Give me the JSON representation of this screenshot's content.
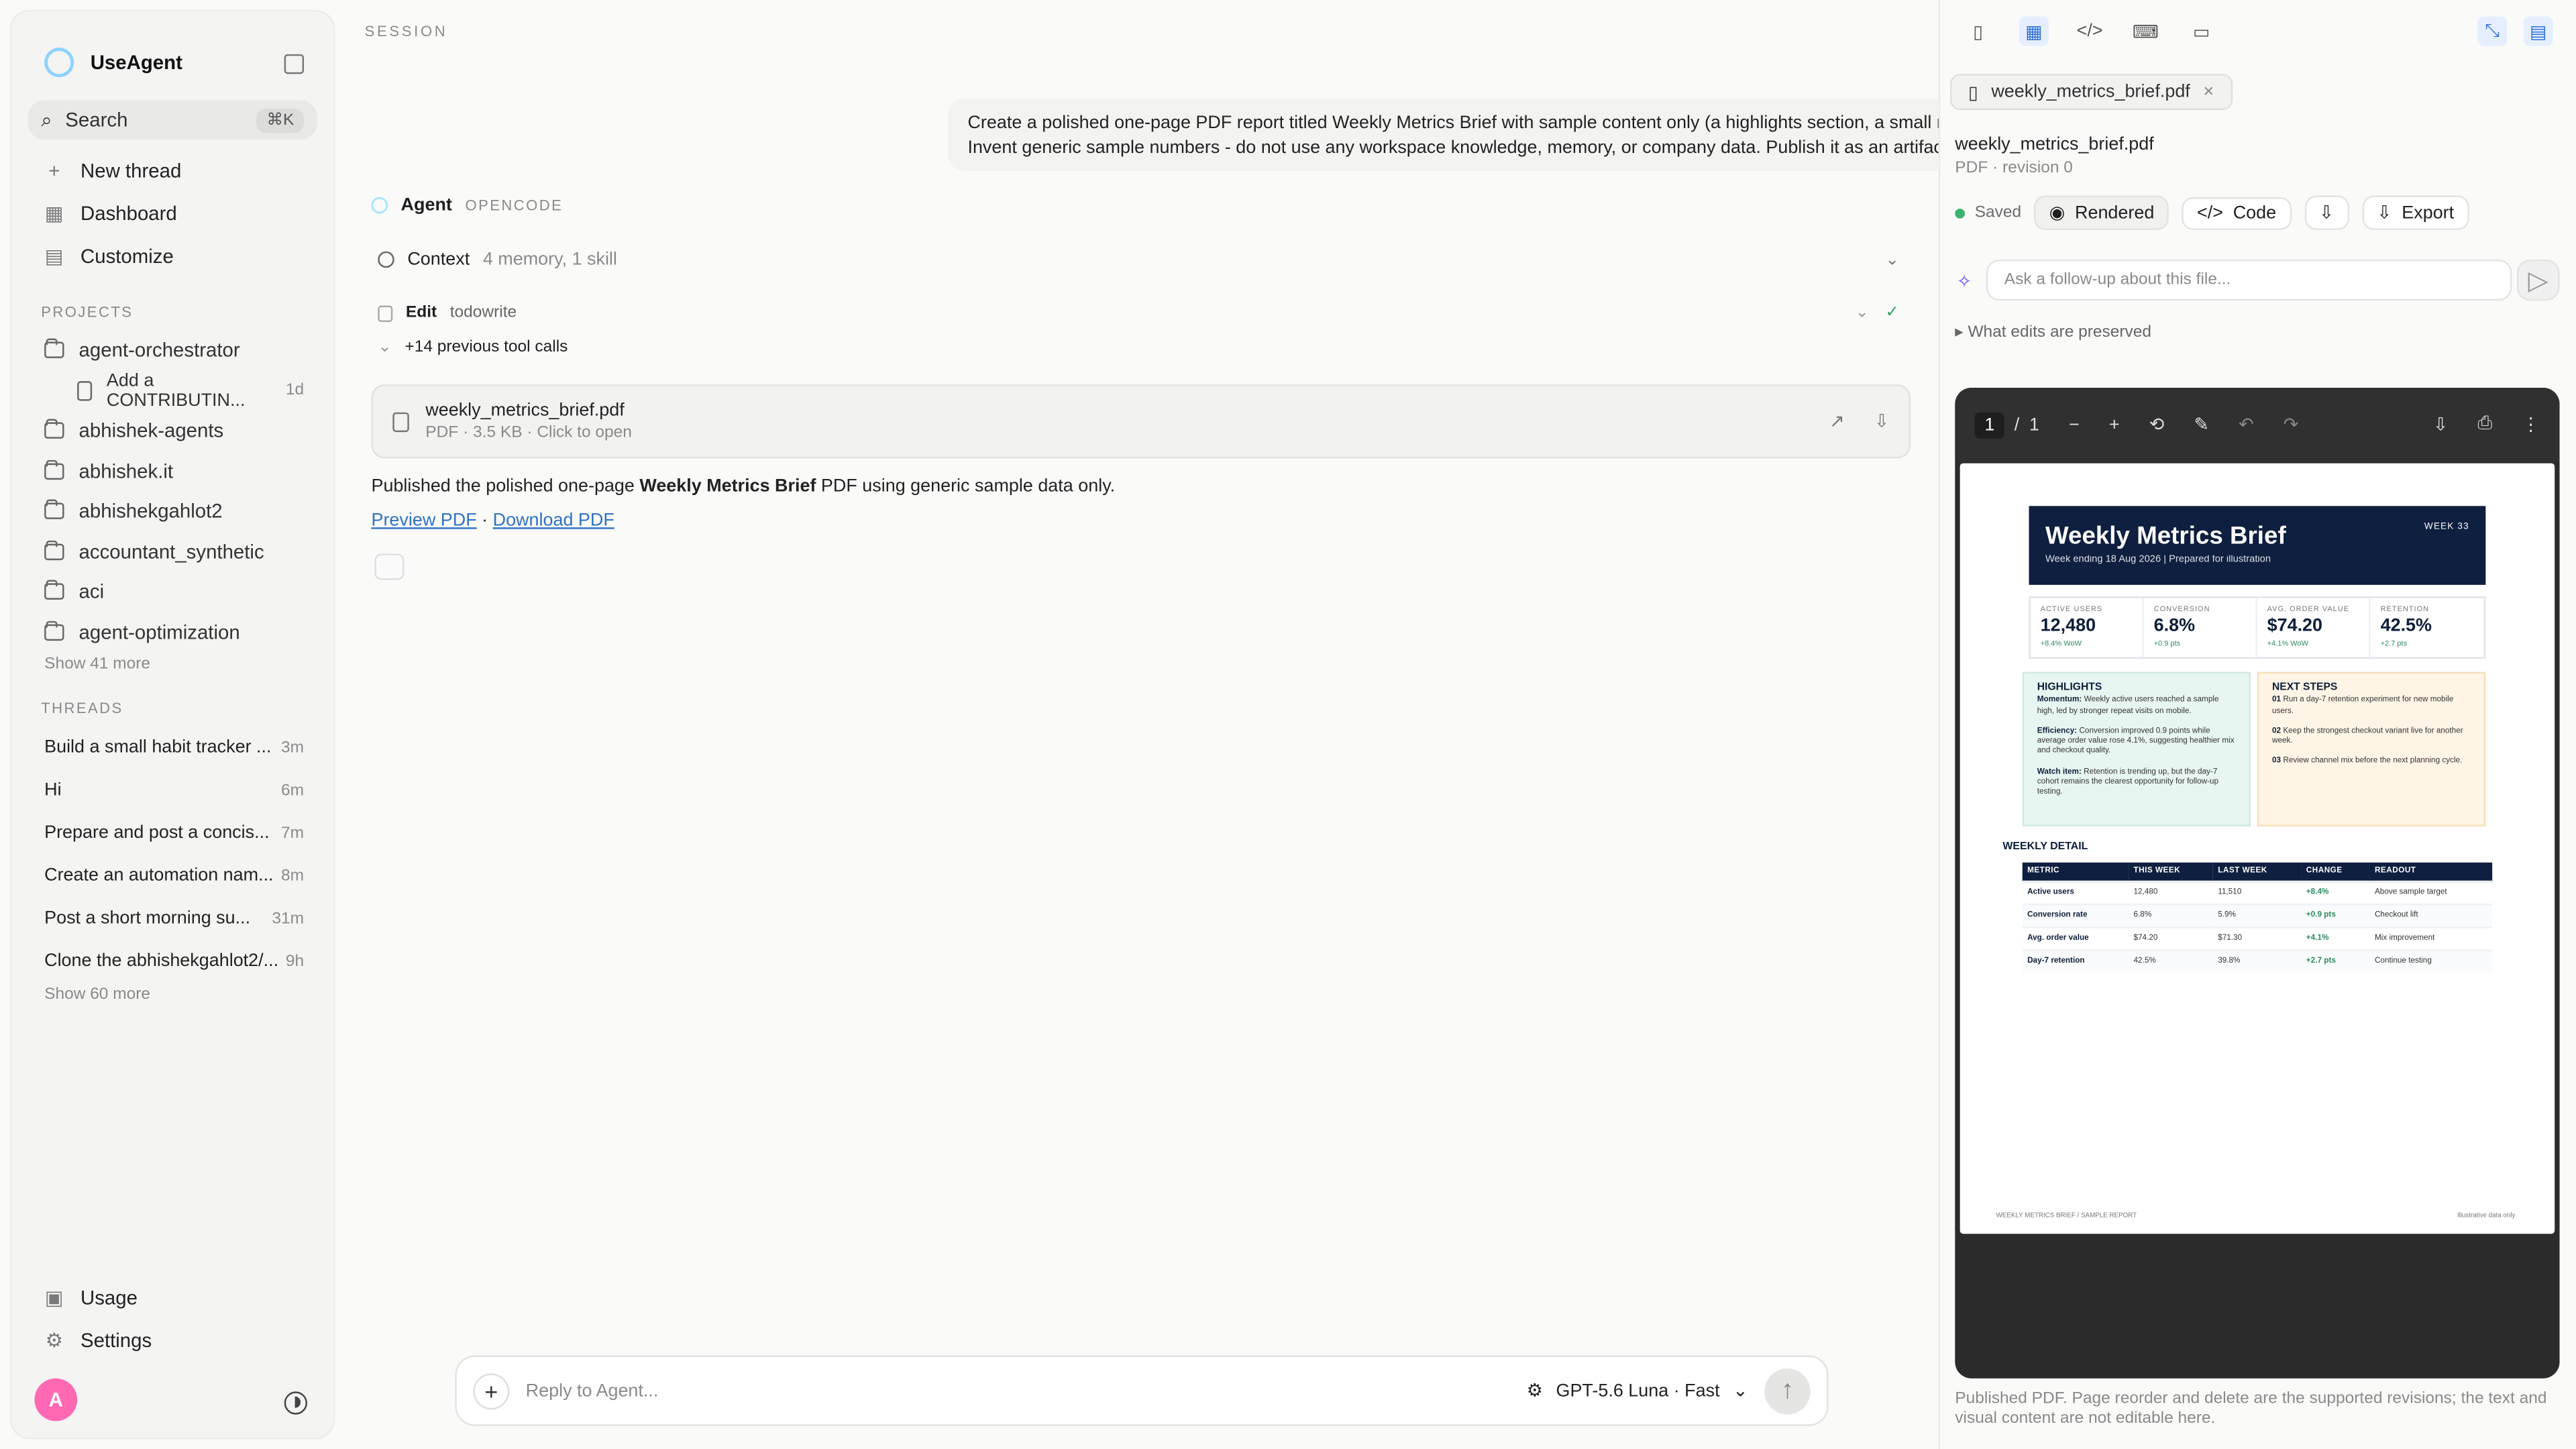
{
  "app": {
    "name": "UseAgent"
  },
  "sidebar": {
    "search": {
      "label": "Search",
      "shortcut": "⌘K"
    },
    "nav": [
      {
        "label": "New thread",
        "icon": "plus-icon"
      },
      {
        "label": "Dashboard",
        "icon": "grid-icon"
      },
      {
        "label": "Customize",
        "icon": "palette-icon"
      }
    ],
    "projects_title": "PROJECTS",
    "projects": [
      {
        "label": "agent-orchestrator"
      },
      {
        "label": "Add a CONTRIBUTIN...",
        "time": "1d",
        "sub": true
      },
      {
        "label": "abhishek-agents"
      },
      {
        "label": "abhishek.it"
      },
      {
        "label": "abhishekgahlot2"
      },
      {
        "label": "accountant_synthetic"
      },
      {
        "label": "aci"
      },
      {
        "label": "agent-optimization"
      }
    ],
    "projects_more": "Show 41 more",
    "threads_title": "THREADS",
    "threads": [
      {
        "label": "Build a small habit tracker ...",
        "time": "3m"
      },
      {
        "label": "Hi",
        "time": "6m"
      },
      {
        "label": "Prepare and post a concis...",
        "time": "7m"
      },
      {
        "label": "Create an automation nam...",
        "time": "8m"
      },
      {
        "label": "Post a short morning su...",
        "time": "31m"
      },
      {
        "label": "Clone the abhishekgahlot2/...",
        "time": "9h"
      }
    ],
    "threads_more": "Show 60 more",
    "bottom": [
      {
        "label": "Usage",
        "icon": "usage-icon"
      },
      {
        "label": "Settings",
        "icon": "gear-icon"
      }
    ],
    "avatar_letter": "A"
  },
  "main": {
    "session_label": "SESSION",
    "prompt": "Create a polished one-page PDF report titled Weekly Metrics Brief with sample content only (a highlights section, a small metrics table, a next steps list). Invent generic sample numbers - do not use any workspace knowledge, memory, or company data. Publish it as an artifact.",
    "agent_label": "Agent",
    "agent_tag": "OPENCODE",
    "context_label": "Context",
    "context_detail": "4 memory, 1 skill",
    "edit_label": "Edit",
    "edit_tool": "todowrite",
    "previous_calls": "+14 previous tool calls",
    "file": {
      "name": "weekly_metrics_brief.pdf",
      "meta": "PDF · 3.5 KB · Click to open"
    },
    "published_pre": "Published the polished one-page ",
    "published_bold": "Weekly Metrics Brief",
    "published_post": " PDF using generic sample data only.",
    "preview_link": "Preview PDF",
    "link_sep": " · ",
    "download_link": "Download PDF",
    "composer_placeholder": "Reply to Agent...",
    "model": "GPT-5.6 Luna · Fast"
  },
  "right": {
    "tab_label": "weekly_metrics_brief.pdf",
    "file_title": "weekly_metrics_brief.pdf",
    "file_sub": "PDF · revision 0",
    "saved": "Saved",
    "rendered": "Rendered",
    "code": "Code",
    "export": "Export",
    "ask_placeholder": "Ask a follow-up about this file...",
    "edits_preserved": "What edits are preserved",
    "viewer": {
      "page": "1",
      "sep": "/",
      "total": "1"
    },
    "footnote": "Published PDF. Page reorder and delete are the supported revisions; the text and visual content are not editable here."
  },
  "pdf": {
    "title": "Weekly Metrics Brief",
    "subtitle": "Week ending 18 Aug 2026 | Prepared for illustration",
    "week": "WEEK 33",
    "kpis": [
      {
        "label": "ACTIVE USERS",
        "value": "12,480",
        "change": "+8.4% WoW"
      },
      {
        "label": "CONVERSION",
        "value": "6.8%",
        "change": "+0.9 pts"
      },
      {
        "label": "AVG. ORDER VALUE",
        "value": "$74.20",
        "change": "+4.1% WoW"
      },
      {
        "label": "RETENTION",
        "value": "42.5%",
        "change": "+2.7 pts"
      }
    ],
    "highlights_title": "HIGHLIGHTS",
    "highlights": [
      {
        "lead": "Momentum:",
        "text": " Weekly active users reached a sample high, led by stronger repeat visits on mobile."
      },
      {
        "lead": "Efficiency:",
        "text": " Conversion improved 0.9 points while average order value rose 4.1%, suggesting healthier mix and checkout quality."
      },
      {
        "lead": "Watch item:",
        "text": " Retention is trending up, but the day-7 cohort remains the clearest opportunity for follow-up testing."
      }
    ],
    "next_title": "NEXT STEPS",
    "next": [
      {
        "n": "01",
        "text": " Run a day-7 retention experiment for new mobile users."
      },
      {
        "n": "02",
        "text": " Keep the strongest checkout variant live for another week."
      },
      {
        "n": "03",
        "text": " Review channel mix before the next planning cycle."
      }
    ],
    "detail_title": "WEEKLY DETAIL",
    "table": {
      "headers": [
        "METRIC",
        "THIS WEEK",
        "LAST WEEK",
        "CHANGE",
        "READOUT"
      ],
      "rows": [
        [
          "Active users",
          "12,480",
          "11,510",
          "+8.4%",
          "Above sample target"
        ],
        [
          "Conversion rate",
          "6.8%",
          "5.9%",
          "+0.9 pts",
          "Checkout lift"
        ],
        [
          "Avg. order value",
          "$74.20",
          "$71.30",
          "+4.1%",
          "Mix improvement"
        ],
        [
          "Day-7 retention",
          "42.5%",
          "39.8%",
          "+2.7 pts",
          "Continue testing"
        ]
      ]
    },
    "footer_left": "WEEKLY METRICS BRIEF  /  SAMPLE REPORT",
    "footer_right": "Illustrative data only"
  }
}
